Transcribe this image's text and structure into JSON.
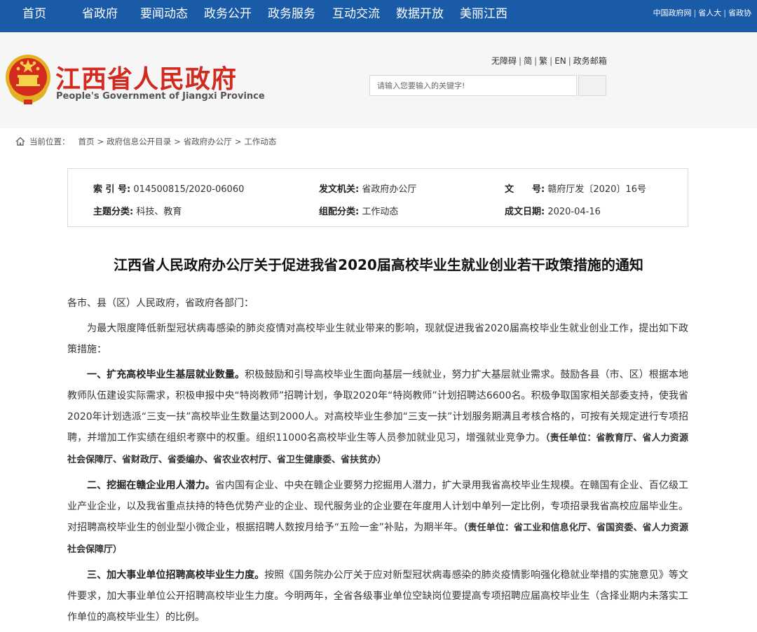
{
  "topnav": {
    "items": [
      "首页",
      "省政府",
      "要闻动态",
      "政务公开",
      "政务服务",
      "互动交流",
      "数据开放",
      "美丽江西"
    ],
    "links": [
      "中国政府网",
      "省人大",
      "省政协"
    ]
  },
  "header": {
    "site_title": "江西省人民政府",
    "site_subtitle": "People's Government of Jiangxi Province",
    "utility_links": [
      "无障碍",
      "简",
      "繁",
      "EN",
      "政务邮箱"
    ],
    "search_placeholder": "请输入您要输入的关键字!"
  },
  "breadcrumb": {
    "label": "当前位置：",
    "items": [
      "首页",
      "政府信息公开目录",
      "省政府办公厅",
      "工作动态"
    ]
  },
  "meta": {
    "index_key": "索 引 号:",
    "index_val": "014500815/2020-06060",
    "issuer_key": "发文机关:",
    "issuer_val": "省政府办公厅",
    "docno_key": "文　　号:",
    "docno_val": "赣府厅发〔2020〕16号",
    "topic_key": "主题分类:",
    "topic_val": "科技、教育",
    "group_key": "组配分类:",
    "group_val": "工作动态",
    "date_key": "成文日期:",
    "date_val": "2020-04-16"
  },
  "article": {
    "title": "江西省人民政府办公厅关于促进我省2020届高校毕业生就业创业若干政策措施的通知",
    "salutation": "各市、县（区）人民政府，省政府各部门：",
    "intro": "为最大限度降低新型冠状病毒感染的肺炎疫情对高校毕业生就业带来的影响，现就促进我省2020届高校毕业生就业创业工作，提出如下政策措施：",
    "p1_head": "一、扩充高校毕业生基层就业数量。",
    "p1_body": "积极鼓励和引导高校毕业生面向基层一线就业，努力扩大基层就业需求。鼓励各县（市、区）根据本地教师队伍建设实际需求，积极申报中央“特岗教师”招聘计划，争取2020年“特岗教师”计划招聘达6600名。积极争取国家相关部委支持，使我省2020年计划选派“三支一扶”高校毕业生数量达到2000人。对高校毕业生参加“三支一扶”计划服务期满且考核合格的，可按有关规定进行专项招聘，并增加工作实绩在组织考察中的权重。组织11000名高校毕业生等人员参加就业见习，增强就业竞争力。",
    "p1_resp": "（责任单位：省教育厅、省人力资源社会保障厅、省财政厅、省委编办、省农业农村厅、省卫生健康委、省扶贫办）",
    "p2_head": "二、挖掘在赣企业用人潜力。",
    "p2_body": "省内国有企业、中央在赣企业要努力挖掘用人潜力，扩大录用我省高校毕业生规模。在赣国有企业、百亿级工业产业企业，以及我省重点扶持的特色优势产业的企业、现代服务业的企业要在年度用人计划中单列一定比例，专项招录我省高校应届毕业生。对招聘高校毕业生的创业型小微企业，根据招聘人数按月给予“五险一金”补贴，为期半年。",
    "p2_resp": "（责任单位：省工业和信息化厅、省国资委、省人力资源社会保障厅）",
    "p3_head": "三、加大事业单位招聘高校毕业生力度。",
    "p3_body": "按照《国务院办公厅关于应对新型冠状病毒感染的肺炎疫情影响强化稳就业举措的实施意见》等文件要求，加大事业单位公开招聘高校毕业生力度。今明两年，全省各级事业单位空缺岗位要提高专项招聘应届高校毕业生（含择业期内未落实工作单位的高校毕业生）的比例。"
  },
  "colors": {
    "nav_bg": "#1a5ba8",
    "title_red": "#d32a1f",
    "header_bg": "#f6f6f6"
  }
}
